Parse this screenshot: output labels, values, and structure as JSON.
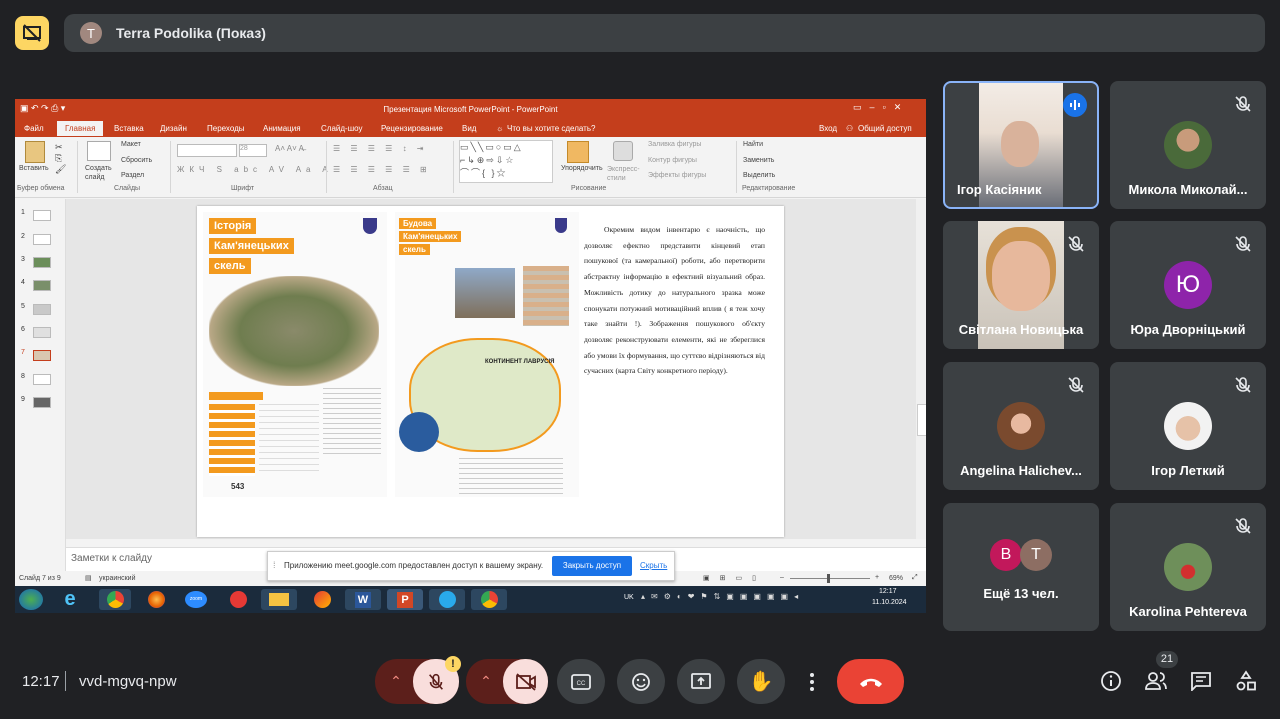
{
  "header": {
    "presenter_initial": "T",
    "title": "Terra Podolika (Показ)",
    "present_icon": "presentation-off-icon"
  },
  "shared_screen": {
    "window_title": "Презентация Microsoft PowerPoint - PowerPoint",
    "menu": [
      "Файл",
      "Главная",
      "Вставка",
      "Дизайн",
      "Переходы",
      "Анимация",
      "Слайд-шоу",
      "Рецензирование",
      "Вид"
    ],
    "tell_me": "Что вы хотите сделать?",
    "sign_in": "Вход",
    "share": "Общий доступ",
    "ribbon": {
      "paste": "Вставить",
      "new_slide": "Создать слайд",
      "layout": "Макет",
      "reset": "Сбросить",
      "section": "Раздел",
      "arrange": "Упорядочить",
      "quick_styles": "Экспресс-стили",
      "shape_fill": "Заливка фигуры",
      "shape_outline": "Контур фигуры",
      "shape_effects": "Эффекты фигуры",
      "find": "Найти",
      "replace": "Заменить",
      "select": "Выделить",
      "groups": [
        "Буфер обмена",
        "Слайды",
        "Шрифт",
        "Абзац",
        "Рисование",
        "Редактирование"
      ],
      "font_size": "28"
    },
    "thumbnails": [
      "1",
      "2",
      "3",
      "4",
      "5",
      "6",
      "7",
      "8",
      "9"
    ],
    "selected_slide": "7",
    "slide": {
      "poster1_title": [
        "Історія",
        "Кам'янецьких",
        "скель"
      ],
      "poster1_number": "543",
      "poster2_title": [
        "Будова",
        "Кам'янецьких",
        "скель"
      ],
      "poster2_map_label": "КОНТИНЕНТ ЛАВРУСІЯ",
      "body_text": "Окремим видом інвентарю є наочність, що дозволяє ефектно представити кінцевий етап пошукової (та камеральної) роботи, або перетворити абстрактну інформацію в ефектний візуальний образ. Можливість дотику до натурального зразка може спонукати потужний мотиваційний вплив ( я теж хочу таке знайти !). Зображення пошукового об'єкту дозволяє реконструювати елементи, які не збереглися або умови їх формування, що суттєво відрізняються від сучасних (карта Світу конкретного періоду)."
    },
    "notes_placeholder": "Заметки к слайду",
    "status": {
      "slide_info": "Слайд 7 из 9",
      "language": "украинский",
      "zoom": "69%"
    },
    "share_banner": {
      "message": "Приложению meet.google.com предоставлен доступ к вашему экрану.",
      "stop": "Закрыть доступ",
      "hide": "Скрыть"
    },
    "taskbar": {
      "lang": "UK",
      "time": "12:17",
      "date": "11.10.2024"
    }
  },
  "participants": [
    {
      "name": "Ігор Касіяник",
      "speaking": true
    },
    {
      "name": "Микола Миколай...",
      "muted": true
    },
    {
      "name": "Світлана Новицька",
      "muted": true
    },
    {
      "name": "Юра Дворніцький",
      "muted": true,
      "letter": "Ю",
      "color": "#8e24aa"
    },
    {
      "name": "Angelina Halichev...",
      "muted": true
    },
    {
      "name": "Ігор Леткий",
      "muted": true
    },
    {
      "name": "Ещё 13 чел.",
      "letters": [
        "B",
        "T"
      ],
      "colors": [
        "#c2185b",
        "#8d6e63"
      ]
    },
    {
      "name": "Karolina Pehtereva",
      "muted": true
    }
  ],
  "bottom_bar": {
    "time": "12:17",
    "meeting_code": "vvd-mgvq-npw",
    "participant_count": "21",
    "warning_badge": "!"
  },
  "colors": {
    "background": "#202124",
    "tile": "#3c4043",
    "accent_red": "#ea4335",
    "accent_blue": "#1a73e8",
    "ppt_red": "#c43e1c",
    "present_yellow": "#fdd663"
  }
}
